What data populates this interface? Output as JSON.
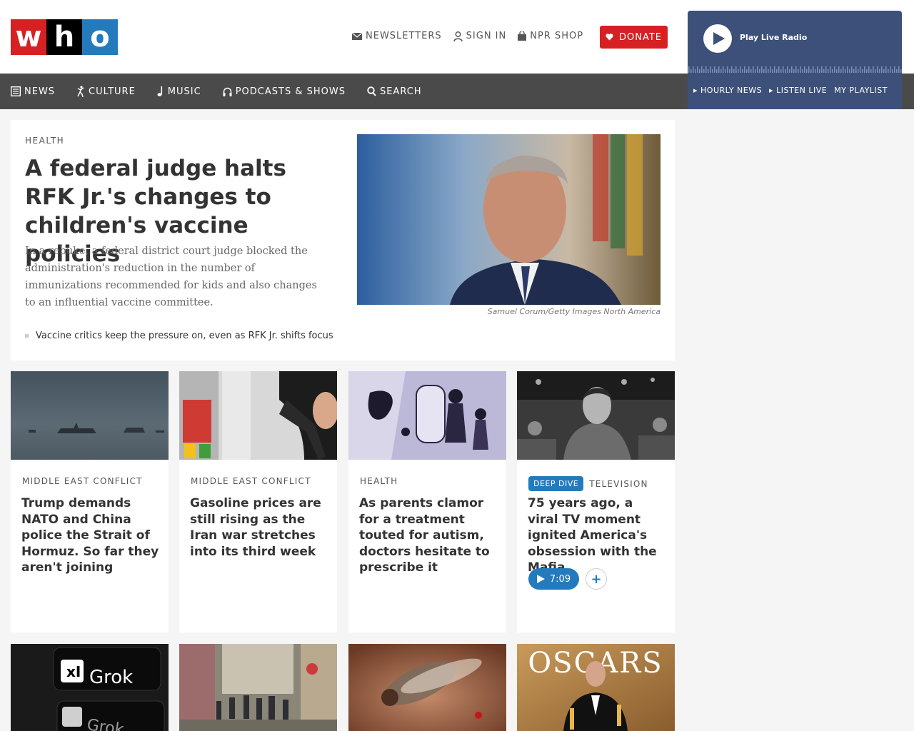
{
  "brand": {
    "logo_letters": [
      "w",
      "h",
      "o"
    ]
  },
  "utility": {
    "newsletters": "NEWSLETTERS",
    "sign_in": "SIGN IN",
    "shop": "NPR SHOP",
    "donate": "DONATE"
  },
  "player": {
    "label": "Play Live Radio",
    "links": [
      "HOURLY NEWS",
      "LISTEN LIVE",
      "MY PLAYLIST"
    ]
  },
  "nav": {
    "items": [
      {
        "label": "NEWS",
        "icon": "newspaper-icon"
      },
      {
        "label": "CULTURE",
        "icon": "dancer-icon"
      },
      {
        "label": "MUSIC",
        "icon": "music-note-icon"
      },
      {
        "label": "PODCASTS & SHOWS",
        "icon": "headphones-icon"
      },
      {
        "label": "SEARCH",
        "icon": "search-icon"
      }
    ]
  },
  "lead": {
    "slug": "HEALTH",
    "title": "A federal judge halts RFK Jr.'s changes to children's vaccine policies",
    "teaser": "In a rebuke, a federal district court judge blocked the administration's reduction in the number of immunizations recommended for kids and also changes to an influential vaccine committee.",
    "credit": "Samuel Corum/Getty Images North America",
    "related": "Vaccine critics keep the pressure on, even as RFK Jr. shifts focus"
  },
  "cards": [
    {
      "slug": "MIDDLE EAST CONFLICT",
      "title": "Trump demands NATO and China police the Strait of Hormuz. So far they aren't joining"
    },
    {
      "slug": "MIDDLE EAST CONFLICT",
      "title": "Gasoline prices are still rising as the Iran war stretches into its third week"
    },
    {
      "slug": "HEALTH",
      "title": "As parents clamor for a treatment touted for autism, doctors hesitate to prescribe it"
    },
    {
      "badge": "DEEP DIVE",
      "slug": "TELEVISION",
      "title": "75 years ago, a viral TV moment ignited America's obsession with the Mafia",
      "duration": "7:09"
    }
  ],
  "bottom_cards": [
    {
      "image_text_top": "Grok",
      "image_text_bottom": "Grok"
    },
    {},
    {},
    {
      "image_text": "OSCARS"
    }
  ],
  "colors": {
    "red": "#d62021",
    "blue": "#237bbd",
    "player": "#3d5079",
    "nav": "#4a4a4a"
  }
}
